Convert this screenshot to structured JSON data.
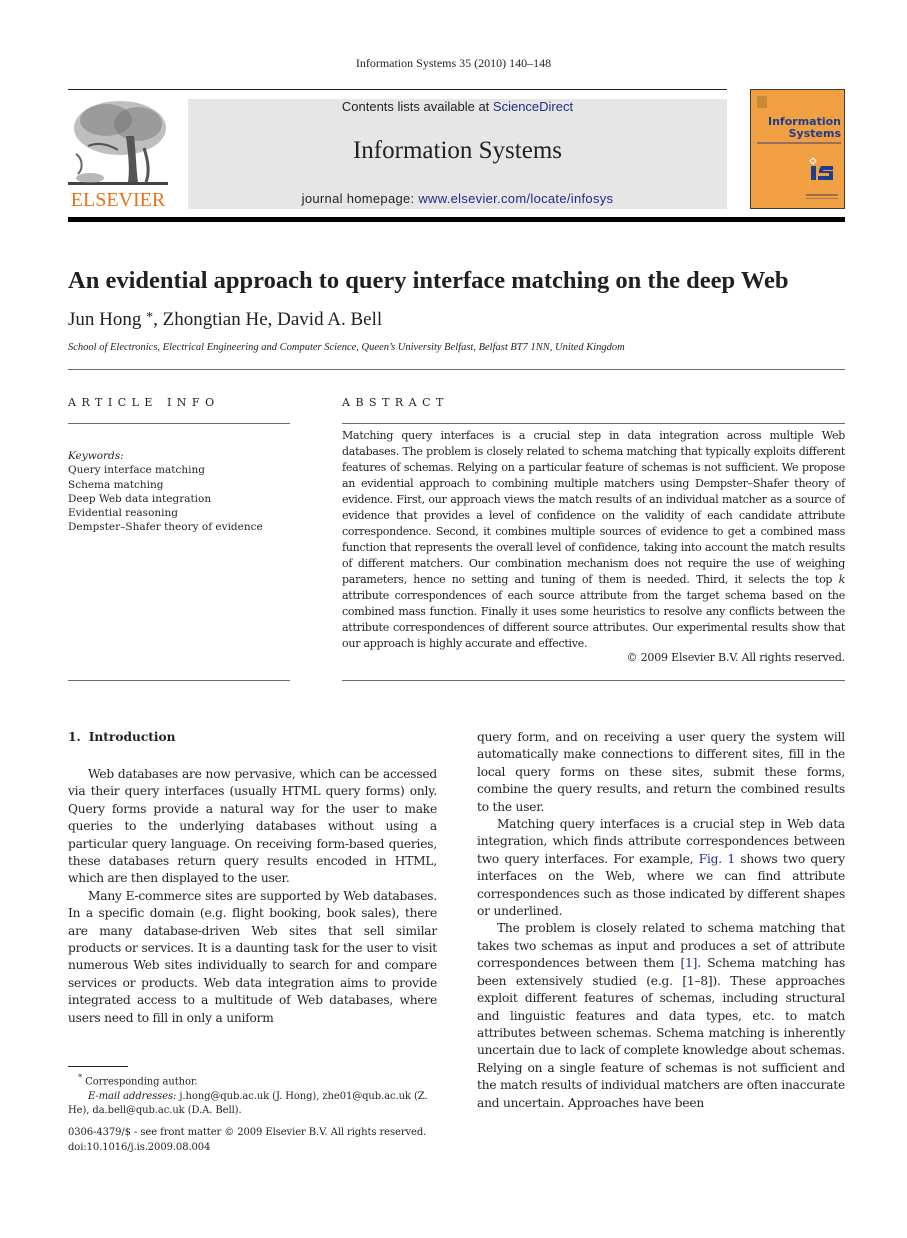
{
  "running_head": "Information Systems 35 (2010) 140–148",
  "masthead": {
    "publisher_logo_text": "ELSEVIER",
    "contents_prefix": "Contents lists available at ",
    "contents_link": "ScienceDirect",
    "journal_name": "Information Systems",
    "homepage_prefix": "journal homepage: ",
    "homepage_link": "www.elsevier.com/locate/infosys",
    "cover_title_line1": "Information",
    "cover_title_line2": "Systems",
    "colors": {
      "link": "#1f2d87",
      "elsevier_orange": "#e9711c",
      "cover_orange": "#f0a043",
      "cover_blue": "#1f3d8e"
    }
  },
  "article": {
    "title": "An evidential approach to query interface matching on the deep Web",
    "authors": [
      {
        "name": "Jun Hong",
        "mark": "*"
      },
      {
        "name": "Zhongtian He",
        "mark": ""
      },
      {
        "name": "David A. Bell",
        "mark": ""
      }
    ],
    "affiliation": "School of Electronics, Electrical Engineering and Computer Science, Queen’s University Belfast, Belfast BT7 1NN, United Kingdom"
  },
  "article_info": {
    "heading": "ARTICLE INFO",
    "keywords_label": "Keywords:",
    "keywords": [
      "Query interface matching",
      "Schema matching",
      "Deep Web data integration",
      "Evidential reasoning",
      "Dempster–Shafer theory of evidence"
    ]
  },
  "abstract": {
    "heading": "ABSTRACT",
    "text_before_k": "Matching query interfaces is a crucial step in data integration across multiple Web databases. The problem is closely related to schema matching that typically exploits different features of schemas. Relying on a particular feature of schemas is not sufficient. We propose an evidential approach to combining multiple matchers using Dempster–Shafer theory of evidence. First, our approach views the match results of an individual matcher as a source of evidence that provides a level of confidence on the validity of each candidate attribute correspondence. Second, it combines multiple sources of evidence to get a combined mass function that represents the overall level of confidence, taking into account the match results of different matchers. Our combination mechanism does not require the use of weighing parameters, hence no setting and tuning of them is needed. Third, it selects the top ",
    "k": "k",
    "text_after_k": " attribute correspondences of each source attribute from the target schema based on the combined mass function. Finally it uses some heuristics to resolve any conflicts between the attribute correspondences of different source attributes. Our experimental results show that our approach is highly accurate and effective.",
    "copyright": "© 2009 Elsevier B.V. All rights reserved."
  },
  "body": {
    "section_number": "1.",
    "section_title": "Introduction",
    "left_paragraphs": [
      "Web databases are now pervasive, which can be accessed via their query interfaces (usually HTML query forms) only. Query forms provide a natural way for the user to make queries to the underlying databases without using a particular query language. On receiving form-based queries, these databases return query results encoded in HTML, which are then displayed to the user.",
      "Many E-commerce sites are supported by Web databases. In a specific domain (e.g. flight booking, book sales), there are many database-driven Web sites that sell similar products or services. It is a daunting task for the user to visit numerous Web sites individually to search for and compare services or products. Web data integration aims to provide integrated access to a multitude of Web databases, where users need to fill in only a uniform"
    ],
    "right_continuation": "query form, and on receiving a user query the system will automatically make connections to different sites, fill in the local query forms on these sites, submit these forms, combine the query results, and return the combined results to the user.",
    "right_p2_before": "Matching query interfaces is a crucial step in Web data integration, which finds attribute correspondences between two query interfaces. For example, ",
    "right_p2_link": "Fig. 1",
    "right_p2_after": " shows two query interfaces on the Web, where we can find attribute correspondences such as those indicated by different shapes or underlined.",
    "right_p3_before": "The problem is closely related to schema matching that takes two schemas as input and produces a set of attribute correspondences between them ",
    "right_p3_link": "[1]",
    "right_p3_after": ". Schema matching has been extensively studied (e.g. [1–8]). These approaches exploit different features of schemas, including structural and linguistic features and data types, etc. to match attributes between schemas. Schema matching is inherently uncertain due to lack of complete knowledge about schemas. Relying on a single feature of schemas is not sufficient and the match results of individual matchers are often inaccurate and uncertain. Approaches have been"
  },
  "footnotes": {
    "corresponding_mark": "*",
    "corresponding_text": " Corresponding author.",
    "email_label": "E-mail addresses:",
    "email_text": " j.hong@qub.ac.uk (J. Hong), zhe01@qub.ac.uk (Z. He), da.bell@qub.ac.uk (D.A. Bell)."
  },
  "front_matter": {
    "issn_line": "0306-4379/$ - see front matter © 2009 Elsevier B.V. All rights reserved.",
    "doi": "doi:10.1016/j.is.2009.08.004"
  }
}
